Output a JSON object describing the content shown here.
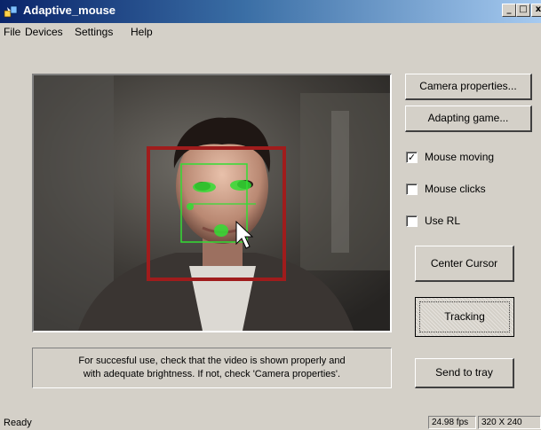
{
  "window": {
    "title": "Adaptive_mouse"
  },
  "titlebar_buttons": {
    "minimize": "_",
    "maximize": "□",
    "close": "x"
  },
  "menu": [
    {
      "label": "File"
    },
    {
      "label": "Devices"
    },
    {
      "label": "Settings"
    },
    {
      "label": "Help"
    }
  ],
  "buttons": {
    "camera_properties": "Camera properties...",
    "adapting_game": "Adapting game...",
    "center_cursor": "Center Cursor",
    "tracking": "Tracking",
    "send_to_tray": "Send to tray"
  },
  "checkboxes": [
    {
      "label": "Mouse moving",
      "checked": true,
      "mark": "✓"
    },
    {
      "label": "Mouse clicks",
      "checked": false,
      "mark": ""
    },
    {
      "label": "Use RL",
      "checked": false,
      "mark": ""
    }
  ],
  "info": {
    "line1": "For succesful use, check that the video is shown properly and",
    "line2": "with adequate brightness. If not, check 'Camera properties'."
  },
  "status": {
    "ready": "Ready",
    "fps": "24.98 fps",
    "resolution": "320 X 240"
  },
  "colors": {
    "titlebar_start": "#0a246a",
    "titlebar_end": "#a6caf0",
    "face_box": "#a01c1c",
    "tracking_marks": "#33dd33"
  }
}
